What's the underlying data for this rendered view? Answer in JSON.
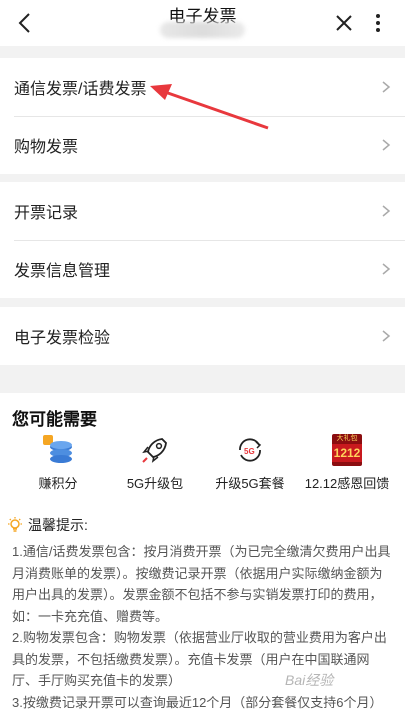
{
  "header": {
    "title": "电子发票"
  },
  "menu_groups": [
    {
      "items": [
        {
          "label": "通信发票/话费发票"
        },
        {
          "label": "购物发票"
        }
      ]
    },
    {
      "items": [
        {
          "label": "开票记录"
        },
        {
          "label": "发票信息管理"
        }
      ]
    },
    {
      "items": [
        {
          "label": "电子发票检验"
        }
      ]
    }
  ],
  "need": {
    "title": "您可能需要",
    "items": [
      {
        "label": "赚积分",
        "icon": "coins-icon"
      },
      {
        "label": "5G升级包",
        "icon": "rocket-icon"
      },
      {
        "label": "升级5G套餐",
        "icon": "5g-refresh-icon"
      },
      {
        "label": "12.12感恩回馈",
        "icon": "gift-1212-icon",
        "badge_top": "大礼包",
        "badge_num": "1212"
      }
    ]
  },
  "tips": {
    "title": "温馨提示:",
    "lines": [
      "1.通信/话费发票包含：按月消费开票（为已完全缴清欠费用户出具月消费账单的发票）。按缴费记录开票（依据用户实际缴纳金额为用户出具的发票）。发票金额不包括不参与实销发票打印的费用，如：一卡充充值、赠费等。",
      "2.购物发票包含：购物发票（依据营业厅收取的营业费用为客户出具的发票，不包括缴费发票）。充值卡发票（用户在中国联通网厅、手厅购买充值卡的发票）",
      "3.按缴费记录开票可以查询最近12个月（部分套餐仅支持6个月）"
    ]
  },
  "watermark": "Bai经验",
  "colors": {
    "arrow": "#e8383d",
    "accent_orange": "#f5a623",
    "icon_blue": "#3a7bd5"
  }
}
